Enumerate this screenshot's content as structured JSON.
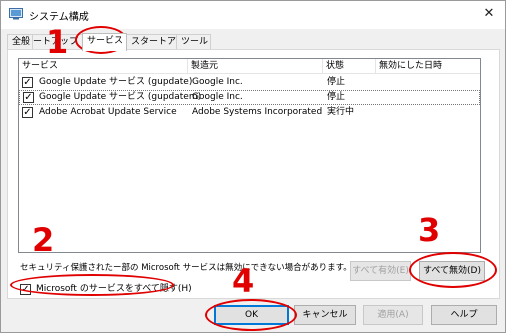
{
  "window": {
    "title": "システム構成",
    "close_glyph": "✕"
  },
  "tabs": [
    {
      "label": "全般"
    },
    {
      "label": "スタートアップ"
    },
    {
      "label": "サービス"
    },
    {
      "label": "スタートアップ"
    },
    {
      "label": "ツール"
    }
  ],
  "list": {
    "columns": [
      "サービス",
      "製造元",
      "状態",
      "無効にした日時"
    ],
    "rows": [
      {
        "checked": true,
        "service": "Google Update サービス (gupdate)",
        "maker": "Google Inc.",
        "status": "停止",
        "disabled_date": ""
      },
      {
        "checked": true,
        "service": "Google Update サービス (gupdatem)",
        "maker": "Google Inc.",
        "status": "停止",
        "disabled_date": ""
      },
      {
        "checked": true,
        "service": "Adobe Acrobat Update Service",
        "maker": "Adobe Systems Incorporated",
        "status": "実行中",
        "disabled_date": ""
      }
    ]
  },
  "info_text": "セキュリティ保護されたー部の Microsoft サービスは無効にできない場合があります。",
  "buttons": {
    "enable_all": "すべて有効(E)",
    "disable_all": "すべて無効(D)",
    "ok": "OK",
    "cancel": "キャンセル",
    "apply": "適用(A)",
    "help": "ヘルプ"
  },
  "hide_ms": {
    "checked": true,
    "label": "Microsoft のサービスをすべて隠す(H)"
  },
  "annotations": {
    "n1": "1",
    "n2": "2",
    "n3": "3",
    "n4": "4",
    "color": "#e00000"
  }
}
